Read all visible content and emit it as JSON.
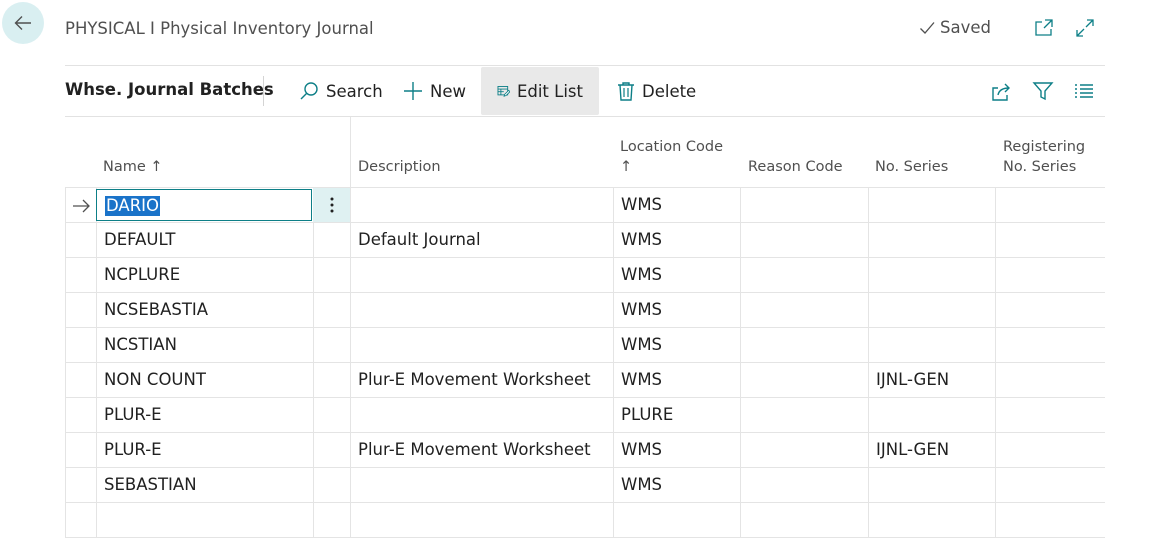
{
  "header": {
    "title": "PHYSICAL I Physical Inventory Journal",
    "saved_label": "Saved"
  },
  "toolbar": {
    "tab_label": "Whse. Journal Batches",
    "search_label": "Search",
    "new_label": "New",
    "edit_list_label": "Edit List",
    "delete_label": "Delete"
  },
  "table": {
    "columns": {
      "name": "Name",
      "description": "Description",
      "location_code": "Location Code",
      "reason_code": "Reason Code",
      "no_series": "No. Series",
      "registering_line1": "Registering",
      "registering_line2": "No. Series",
      "sort_arrow": "↑"
    },
    "rows": [
      {
        "name": "DARIO",
        "description": "",
        "location_code": "WMS",
        "reason_code": "",
        "no_series": "",
        "registering": ""
      },
      {
        "name": "DEFAULT",
        "description": "Default Journal",
        "location_code": "WMS",
        "reason_code": "",
        "no_series": "",
        "registering": ""
      },
      {
        "name": "NCPLURE",
        "description": "",
        "location_code": "WMS",
        "reason_code": "",
        "no_series": "",
        "registering": ""
      },
      {
        "name": "NCSEBASTIA",
        "description": "",
        "location_code": "WMS",
        "reason_code": "",
        "no_series": "",
        "registering": ""
      },
      {
        "name": "NCSTIAN",
        "description": "",
        "location_code": "WMS",
        "reason_code": "",
        "no_series": "",
        "registering": ""
      },
      {
        "name": "NON COUNT",
        "description": "Plur-E Movement Worksheet",
        "location_code": "WMS",
        "reason_code": "",
        "no_series": "IJNL-GEN",
        "registering": ""
      },
      {
        "name": "PLUR-E",
        "description": "",
        "location_code": "PLURE",
        "reason_code": "",
        "no_series": "",
        "registering": ""
      },
      {
        "name": "PLUR-E",
        "description": "Plur-E Movement Worksheet",
        "location_code": "WMS",
        "reason_code": "",
        "no_series": "IJNL-GEN",
        "registering": ""
      },
      {
        "name": "SEBASTIAN",
        "description": "",
        "location_code": "WMS",
        "reason_code": "",
        "no_series": "",
        "registering": ""
      },
      {
        "name": "",
        "description": "",
        "location_code": "",
        "reason_code": "",
        "no_series": "",
        "registering": ""
      }
    ]
  },
  "colors": {
    "accent": "#0d7f87",
    "selection": "#1a73c9",
    "back_button_bg": "#d9eff1",
    "active_action_bg": "#e9e9e9"
  },
  "icons": {
    "back": "back-arrow-icon",
    "saved": "checkmark-icon",
    "open_new_window": "open-in-new-window-icon",
    "expand": "expand-icon",
    "search": "search-icon",
    "new": "plus-icon",
    "edit_list": "edit-list-icon",
    "delete": "trash-icon",
    "share": "share-icon",
    "filter": "filter-icon",
    "list_view": "list-view-icon",
    "row_selector": "row-arrow-icon",
    "row_actions": "vertical-ellipsis-icon"
  }
}
